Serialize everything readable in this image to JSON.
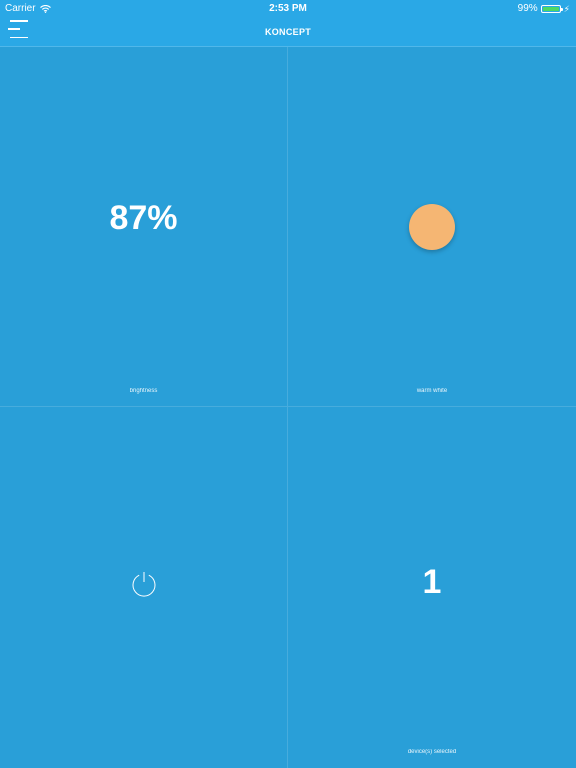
{
  "status_bar": {
    "carrier": "Carrier",
    "time": "2:53 PM",
    "battery": "99%",
    "battery_level": 0.99
  },
  "nav": {
    "title": "KONCEPT"
  },
  "tiles": {
    "brightness": {
      "value": "87%",
      "label": "brightness"
    },
    "color": {
      "label": "warm white",
      "swatch": "#f5b673"
    },
    "power": {
      "icon": "power-icon"
    },
    "devices": {
      "value": "1",
      "label": "device(s) selected"
    }
  },
  "colors": {
    "background": "#299fd8",
    "nav_bar": "#2aa8e6"
  }
}
